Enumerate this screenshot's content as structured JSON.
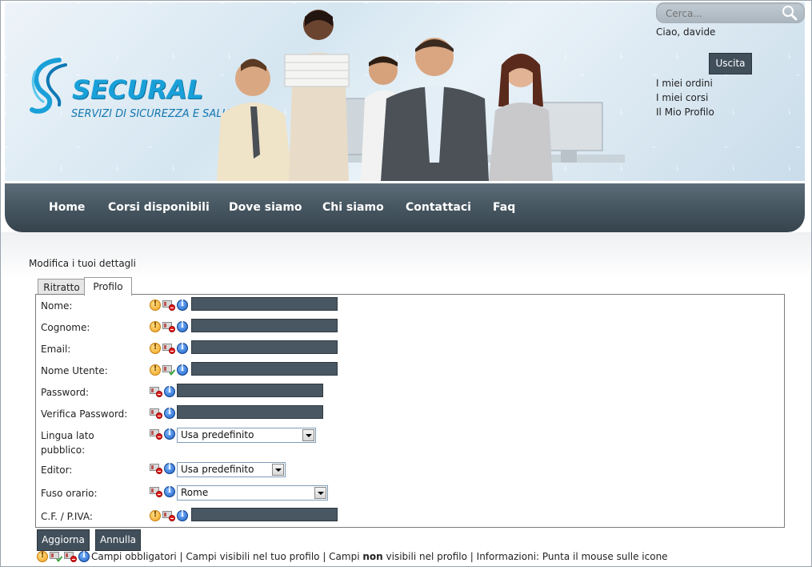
{
  "header": {
    "logo": {
      "brand": "SECURAL",
      "tagline": "SERVIZI DI SICUREZZA E SALUTE"
    },
    "search": {
      "placeholder": "Cerca..."
    },
    "greeting": "Ciao, davide",
    "logout_label": "Uscita",
    "user_links": [
      "I miei ordini",
      "I miei corsi",
      "Il Mio Profilo"
    ]
  },
  "nav": {
    "items": [
      "Home",
      "Corsi disponibili",
      "Dove siamo",
      "Chi siamo",
      "Contattaci",
      "Faq"
    ]
  },
  "page": {
    "title": "Modifica i tuoi dettagli"
  },
  "tabs": [
    "Ritratto",
    "Profilo"
  ],
  "form": {
    "fields": [
      {
        "label": "Nome:",
        "icons": [
          "warning",
          "hidden",
          "info"
        ],
        "type": "text",
        "value": ""
      },
      {
        "label": "Cognome:",
        "icons": [
          "warning",
          "hidden",
          "info"
        ],
        "type": "text",
        "value": ""
      },
      {
        "label": "Email:",
        "icons": [
          "warning",
          "hidden",
          "info"
        ],
        "type": "text",
        "value": ""
      },
      {
        "label": "Nome Utente:",
        "icons": [
          "warning",
          "visible",
          "info"
        ],
        "type": "text",
        "value": ""
      },
      {
        "label": "Password:",
        "icons": [
          "hidden",
          "info"
        ],
        "type": "password",
        "value": ""
      },
      {
        "label": "Verifica Password:",
        "icons": [
          "hidden",
          "info"
        ],
        "type": "password",
        "value": ""
      },
      {
        "label": "Lingua lato pubblico:",
        "icons": [
          "hidden",
          "info"
        ],
        "type": "select",
        "value": "Usa predefinito"
      },
      {
        "label": "Editor:",
        "icons": [
          "hidden",
          "info"
        ],
        "type": "select",
        "value": "Usa predefinito"
      },
      {
        "label": "Fuso orario:",
        "icons": [
          "hidden",
          "info"
        ],
        "type": "select",
        "value": "Rome"
      },
      {
        "label": "C.F. / P.IVA:",
        "icons": [
          "warning",
          "hidden",
          "info"
        ],
        "type": "text",
        "value": ""
      }
    ],
    "update_label": "Aggiorna",
    "cancel_label": "Annulla"
  },
  "legend": {
    "required": "Campi obbligatori",
    "sep1": " | ",
    "visible": "Campi visibili nel tuo profilo",
    "sep2": " | ",
    "hidden_prefix": "Campi ",
    "hidden_emph": "non",
    "hidden_suffix": " visibili nel profilo",
    "sep3": " | ",
    "info": "Informazioni: Punta il mouse sulle icone"
  },
  "colors": {
    "nav_dark": "#36434d",
    "button": "#414f5b",
    "field_fill": "#485762",
    "logo_blue": "#1aa0d8"
  }
}
